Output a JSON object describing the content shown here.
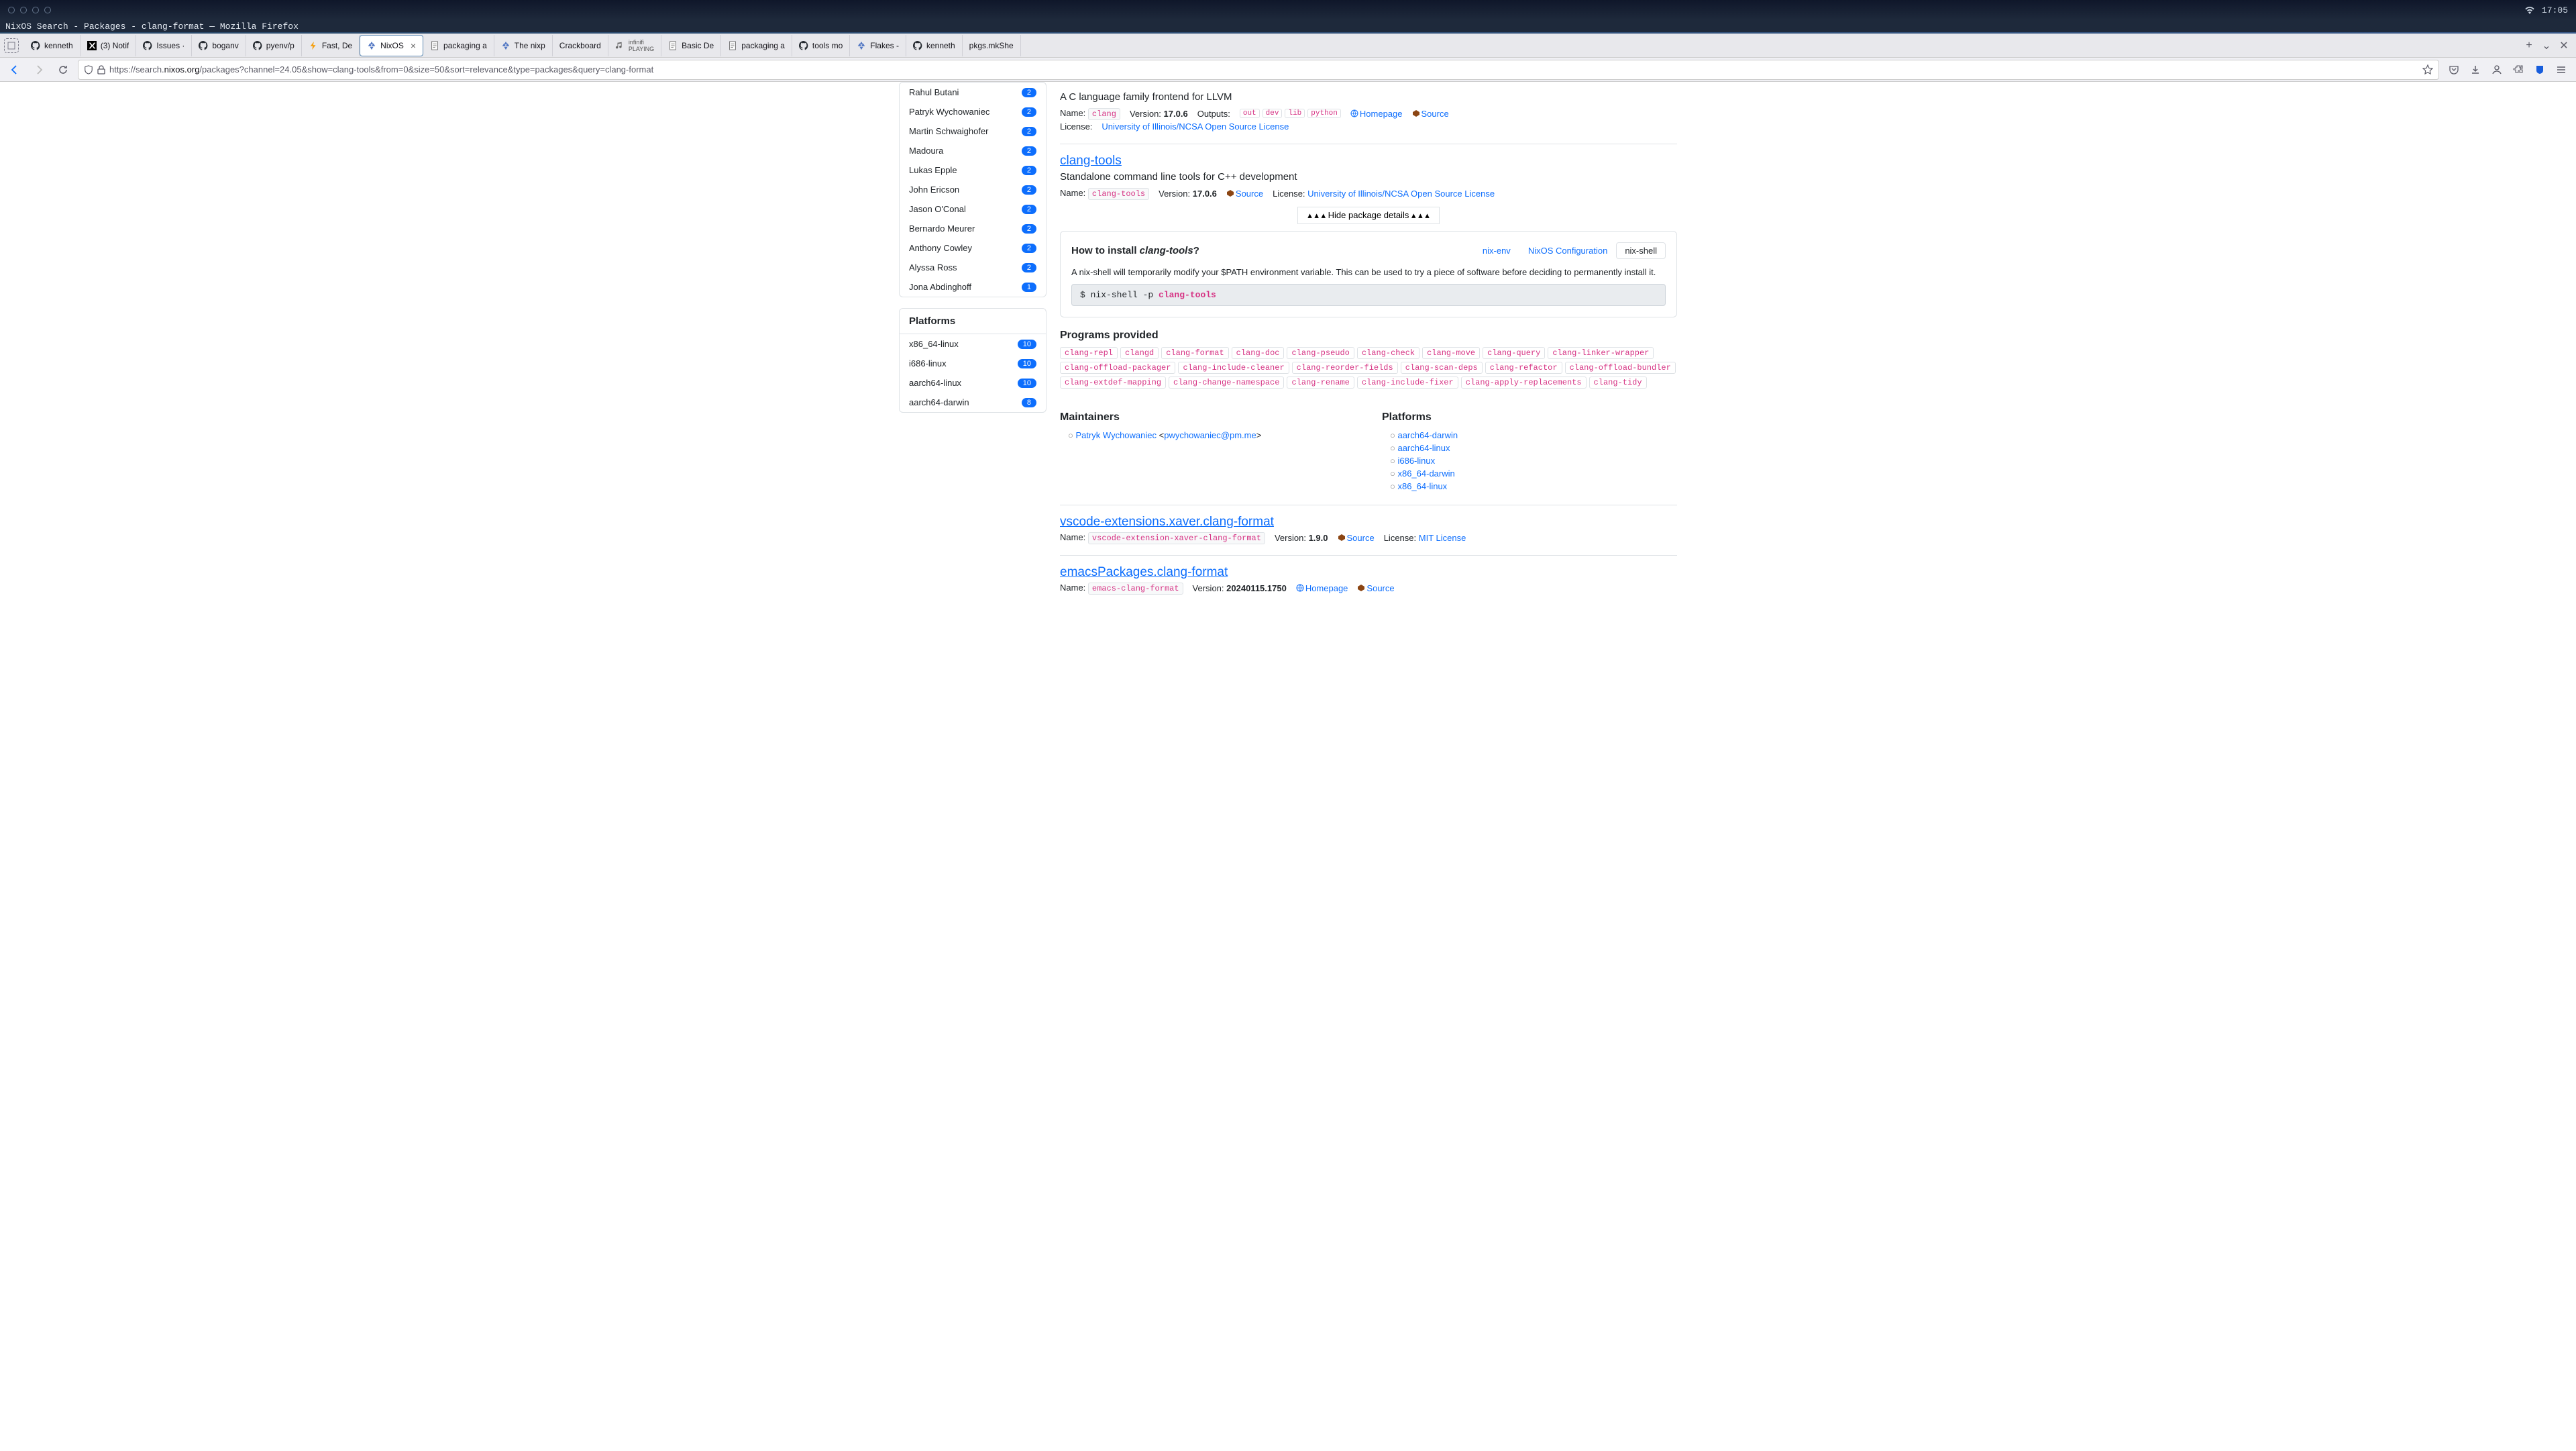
{
  "os": {
    "time": "17:05"
  },
  "window": {
    "title": "NixOS Search - Packages - clang-format — Mozilla Firefox"
  },
  "tabs": [
    {
      "label": "kenneth"
    },
    {
      "label": "(3) Notif"
    },
    {
      "label": "Issues ·"
    },
    {
      "label": "boganv"
    },
    {
      "label": "pyenv/p"
    },
    {
      "label": "Fast, De"
    },
    {
      "label": "NixOS",
      "active": true
    },
    {
      "label": "packaging a"
    },
    {
      "label": "The nixp"
    },
    {
      "label": "Crackboard"
    },
    {
      "label_top": "infinifi",
      "label_bottom": "PLAYING"
    },
    {
      "label": "Basic De"
    },
    {
      "label": "packaging a"
    },
    {
      "label": "tools mo"
    },
    {
      "label": "Flakes -"
    },
    {
      "label": "kenneth"
    },
    {
      "label": "pkgs.mkShe"
    }
  ],
  "url": {
    "proto": "https://",
    "sub": "search.",
    "domain": "nixos.org",
    "path": "/packages?channel=24.05&show=clang-tools&from=0&size=50&sort=relevance&type=packages&query=clang-format"
  },
  "sidebar": {
    "maintainers": [
      {
        "name": "Rahul Butani",
        "count": "2"
      },
      {
        "name": "Patryk Wychowaniec",
        "count": "2"
      },
      {
        "name": "Martin Schwaighofer",
        "count": "2"
      },
      {
        "name": "Madoura",
        "count": "2"
      },
      {
        "name": "Lukas Epple",
        "count": "2"
      },
      {
        "name": "John Ericson",
        "count": "2"
      },
      {
        "name": "Jason O'Conal",
        "count": "2"
      },
      {
        "name": "Bernardo Meurer",
        "count": "2"
      },
      {
        "name": "Anthony Cowley",
        "count": "2"
      },
      {
        "name": "Alyssa Ross",
        "count": "2"
      },
      {
        "name": "Jona Abdinghoff",
        "count": "1"
      }
    ],
    "platforms_title": "Platforms",
    "platforms": [
      {
        "name": "x86_64-linux",
        "count": "10"
      },
      {
        "name": "i686-linux",
        "count": "10"
      },
      {
        "name": "aarch64-linux",
        "count": "10"
      },
      {
        "name": "aarch64-darwin",
        "count": "8"
      }
    ]
  },
  "results": {
    "r0": {
      "desc": "A C language family frontend for LLVM",
      "name_label": "Name:",
      "name": "clang",
      "version_label": "Version:",
      "version": "17.0.6",
      "outputs_label": "Outputs:",
      "outputs": [
        "out",
        "dev",
        "lib",
        "python"
      ],
      "homepage": "Homepage",
      "source": "Source",
      "license_label": "License:",
      "license": "University of Illinois/NCSA Open Source License"
    },
    "r1": {
      "title": "clang-tools",
      "desc": "Standalone command line tools for C++ development",
      "name_label": "Name:",
      "name": "clang-tools",
      "version_label": "Version:",
      "version": "17.0.6",
      "source": "Source",
      "license_label": "License:",
      "license": "University of Illinois/NCSA Open Source License",
      "hide_details": "▴ ▴ ▴  Hide package details  ▴ ▴ ▴",
      "howto_prefix": "How to install ",
      "howto_pkg": "clang-tools",
      "howto_suffix": "?",
      "install_tabs": {
        "nixenv": "nix-env",
        "nixconf": "NixOS Configuration",
        "nixshell": "nix-shell"
      },
      "note": "A nix-shell will temporarily modify your $PATH environment variable. This can be used to try a piece of software before deciding to permanently install it.",
      "cmd_prefix": "$ nix-shell -p ",
      "cmd_pkg": "clang-tools",
      "programs_title": "Programs provided",
      "programs": [
        "clang-repl",
        "clangd",
        "clang-format",
        "clang-doc",
        "clang-pseudo",
        "clang-check",
        "clang-move",
        "clang-query",
        "clang-linker-wrapper",
        "clang-offload-packager",
        "clang-include-cleaner",
        "clang-reorder-fields",
        "clang-scan-deps",
        "clang-refactor",
        "clang-offload-bundler",
        "clang-extdef-mapping",
        "clang-change-namespace",
        "clang-rename",
        "clang-include-fixer",
        "clang-apply-replacements",
        "clang-tidy"
      ],
      "maintainers_title": "Maintainers",
      "maintainer_name": "Patryk Wychowaniec",
      "maintainer_email": "pwychowaniec@pm.me",
      "platforms_title": "Platforms",
      "platforms": [
        "aarch64-darwin",
        "aarch64-linux",
        "i686-linux",
        "x86_64-darwin",
        "x86_64-linux"
      ]
    },
    "r2": {
      "title": "vscode-extensions.xaver.clang-format",
      "name_label": "Name:",
      "name": "vscode-extension-xaver-clang-format",
      "version_label": "Version:",
      "version": "1.9.0",
      "source": "Source",
      "license_label": "License:",
      "license": "MIT License"
    },
    "r3": {
      "title": "emacsPackages.clang-format",
      "name_label": "Name:",
      "name": "emacs-clang-format",
      "version_label": "Version:",
      "version": "20240115.1750",
      "homepage": "Homepage",
      "source": "Source"
    }
  }
}
